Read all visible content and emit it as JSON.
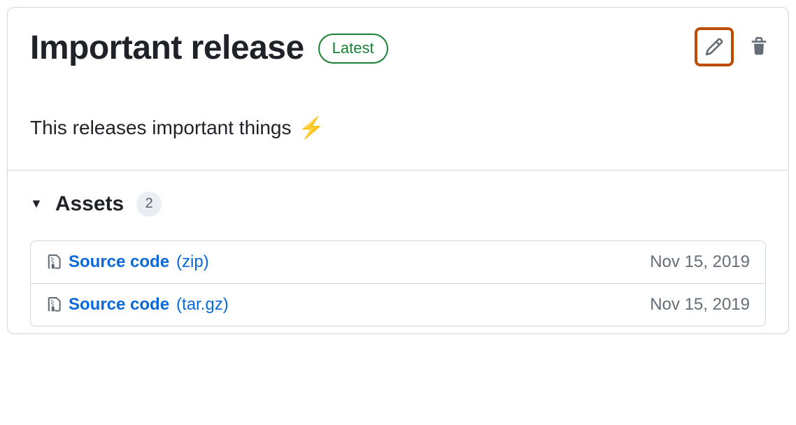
{
  "release": {
    "title": "Important release",
    "badge": "Latest",
    "description": "This releases important things",
    "emoji": "⚡"
  },
  "assets": {
    "label": "Assets",
    "count": "2",
    "items": [
      {
        "name": "Source code",
        "ext": "(zip)",
        "date": "Nov 15, 2019"
      },
      {
        "name": "Source code",
        "ext": "(tar.gz)",
        "date": "Nov 15, 2019"
      }
    ]
  }
}
